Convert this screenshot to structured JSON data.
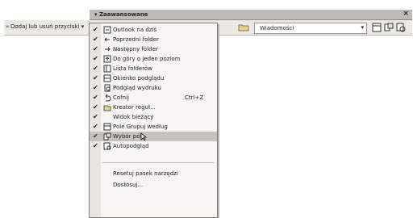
{
  "title": "Zaawansowane",
  "close": "×",
  "toolbar": {
    "chevron": "»",
    "add_remove_label": "Dodaj lub usuń przyciski",
    "add_remove_arrow": "▾",
    "combo_value": "Wiadomości",
    "combo_arrow": "▾"
  },
  "menu": {
    "items": [
      {
        "label": "Outlook na dziś",
        "icon": "outlook-today-icon",
        "checked": true
      },
      {
        "label": "Poprzedni folder",
        "icon": "back-arrow-icon",
        "checked": true
      },
      {
        "label": "Następny folder",
        "icon": "forward-arrow-icon",
        "checked": true
      },
      {
        "label": "Do góry o jeden poziom",
        "icon": "up-one-level-icon",
        "checked": true
      },
      {
        "label": "Lista folderów",
        "icon": "folder-list-icon",
        "checked": true
      },
      {
        "label": "Okienko podglądu",
        "icon": "preview-pane-icon",
        "checked": true
      },
      {
        "label": "Podgląd wydruku",
        "icon": "print-preview-icon",
        "checked": true
      },
      {
        "label": "Cofnij",
        "shortcut": "Ctrl+Z",
        "icon": "undo-icon",
        "checked": true
      },
      {
        "label": "Kreator reguł...",
        "icon": "rules-wizard-icon",
        "checked": true
      },
      {
        "label": "Widok bieżący",
        "icon": "",
        "checked": true
      },
      {
        "label": "Pole Grupuj według",
        "icon": "group-by-box-icon",
        "checked": true
      },
      {
        "label": "Wybór pól",
        "icon": "field-chooser-icon",
        "checked": true
      },
      {
        "label": "Autopodgląd",
        "icon": "autopreview-icon",
        "checked": true
      }
    ],
    "highlighted_index": 11,
    "reset_label": "Resetuj pasek narzędzi",
    "customize_label": "Dostosuj..."
  }
}
